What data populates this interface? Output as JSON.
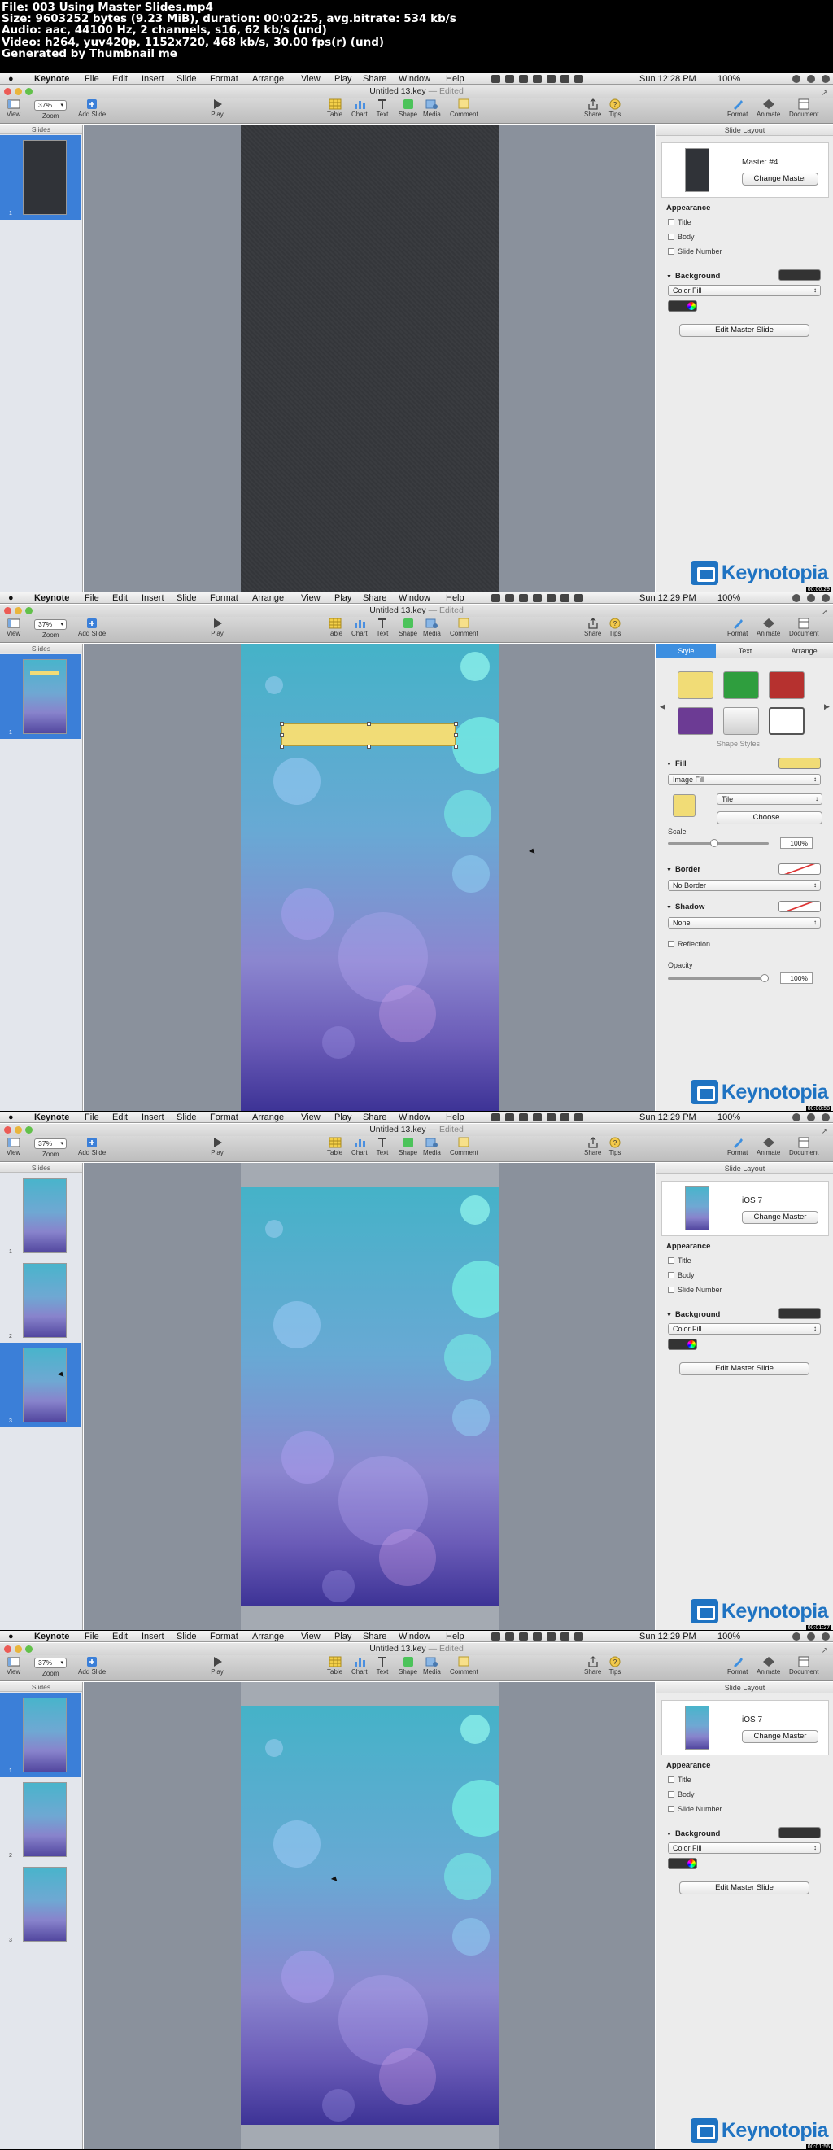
{
  "header": {
    "lines": [
      "File: 003 Using Master Slides.mp4",
      "Size: 9603252 bytes (9.23 MiB), duration: 00:02:25, avg.bitrate: 534 kb/s",
      "Audio: aac, 44100 Hz, 2 channels, s16, 62 kb/s (und)",
      "Video: h264, yuv420p, 1152x720, 468 kb/s, 30.00 fps(r) (und)",
      "Generated by Thumbnail me"
    ]
  },
  "menubar": {
    "app": "Keynote",
    "items": [
      "File",
      "Edit",
      "Insert",
      "Slide",
      "Format",
      "Arrange",
      "View",
      "Play",
      "Share",
      "Window",
      "Help"
    ],
    "battery": "100%"
  },
  "window": {
    "doc": "Untitled 13.key",
    "edited": "— Edited"
  },
  "toolbar": {
    "view": "View",
    "zoom_value": "37%",
    "zoom": "Zoom",
    "add_slide": "Add Slide",
    "play": "Play",
    "table": "Table",
    "chart": "Chart",
    "text": "Text",
    "shape": "Shape",
    "media": "Media",
    "comment": "Comment",
    "share": "Share",
    "tips": "Tips",
    "format": "Format",
    "animate": "Animate",
    "document": "Document"
  },
  "sidebar": {
    "header": "Slides"
  },
  "inspector": {
    "slide_layout": "Slide Layout",
    "change_master": "Change Master",
    "appearance": "Appearance",
    "title": "Title",
    "body": "Body",
    "slide_number": "Slide Number",
    "background": "Background",
    "color_fill": "Color Fill",
    "edit_master": "Edit Master Slide"
  },
  "shape_inspector": {
    "tabs": [
      "Style",
      "Text",
      "Arrange"
    ],
    "shape_styles": "Shape Styles",
    "fill": "Fill",
    "image_fill": "Image Fill",
    "tile": "Tile",
    "choose": "Choose...",
    "scale": "Scale",
    "scale_value": "100%",
    "border": "Border",
    "no_border": "No Border",
    "shadow": "Shadow",
    "none": "None",
    "reflection": "Reflection",
    "opacity": "Opacity",
    "opacity_value": "100%"
  },
  "frames": [
    {
      "time": "Sun 12:28 PM",
      "master_name": "Master #4",
      "stamp": "00:00:29"
    },
    {
      "time": "Sun 12:29 PM",
      "stamp": "00:00:58"
    },
    {
      "time": "Sun 12:29 PM",
      "master_name": "iOS 7",
      "stamp": "00:01:27"
    },
    {
      "time": "Sun 12:29 PM",
      "master_name": "iOS 7",
      "stamp": "00:01:56"
    }
  ],
  "watermark": "Keynotopia",
  "colors": {
    "accent": "#3b7fd8",
    "brand": "#1f73c2",
    "style_active": "#3d8fe0"
  }
}
